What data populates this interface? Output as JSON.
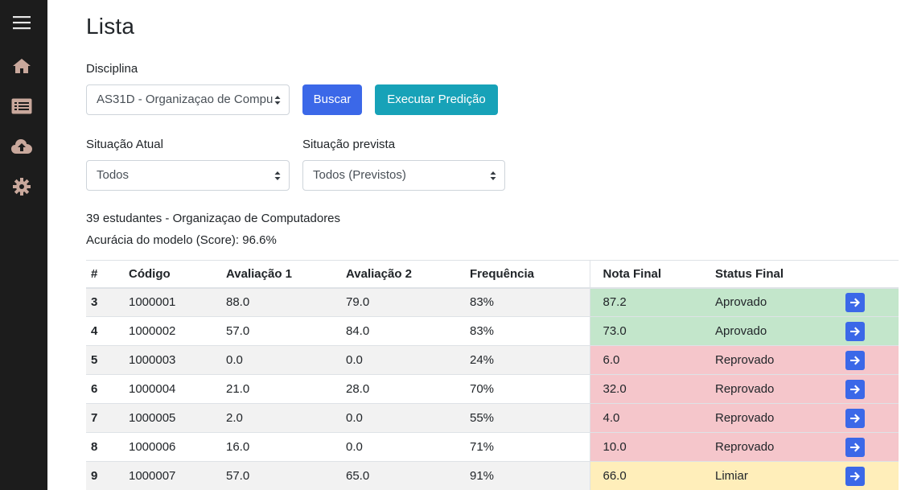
{
  "sidebar": {
    "items": [
      {
        "icon": "menu-icon"
      },
      {
        "icon": "home-icon"
      },
      {
        "icon": "list-icon"
      },
      {
        "icon": "cloud-upload-icon"
      },
      {
        "icon": "gear-icon"
      }
    ],
    "icon_color": "#c9a89c"
  },
  "page": {
    "title": "Lista"
  },
  "filters": {
    "disciplina_label": "Disciplina",
    "disciplina_value": "AS31D - Organizaçao de Compu",
    "buscar_label": "Buscar",
    "executar_label": "Executar Predição",
    "situacao_atual_label": "Situação Atual",
    "situacao_atual_value": "Todos",
    "situacao_prevista_label": "Situação prevista",
    "situacao_prevista_value": "Todos (Previstos)"
  },
  "summary": {
    "students": "39 estudantes - Organizaçao de Computadores",
    "accuracy": "Acurácia do modelo (Score): 96.6%"
  },
  "table": {
    "headers": [
      "#",
      "Código",
      "Avaliação 1",
      "Avaliação 2",
      "Frequência",
      "Nota Final",
      "Status Final"
    ],
    "rows": [
      {
        "num": "3",
        "codigo": "1000001",
        "av1": "88.0",
        "av2": "79.0",
        "freq": "83%",
        "nota": "87.2",
        "status": "Aprovado",
        "tone": "ok"
      },
      {
        "num": "4",
        "codigo": "1000002",
        "av1": "57.0",
        "av2": "84.0",
        "freq": "83%",
        "nota": "73.0",
        "status": "Aprovado",
        "tone": "ok"
      },
      {
        "num": "5",
        "codigo": "1000003",
        "av1": "0.0",
        "av2": "0.0",
        "freq": "24%",
        "nota": "6.0",
        "status": "Reprovado",
        "tone": "bad"
      },
      {
        "num": "6",
        "codigo": "1000004",
        "av1": "21.0",
        "av2": "28.0",
        "freq": "70%",
        "nota": "32.0",
        "status": "Reprovado",
        "tone": "bad"
      },
      {
        "num": "7",
        "codigo": "1000005",
        "av1": "2.0",
        "av2": "0.0",
        "freq": "55%",
        "nota": "4.0",
        "status": "Reprovado",
        "tone": "bad"
      },
      {
        "num": "8",
        "codigo": "1000006",
        "av1": "16.0",
        "av2": "0.0",
        "freq": "71%",
        "nota": "10.0",
        "status": "Reprovado",
        "tone": "bad"
      },
      {
        "num": "9",
        "codigo": "1000007",
        "av1": "57.0",
        "av2": "65.0",
        "freq": "91%",
        "nota": "66.0",
        "status": "Limiar",
        "tone": "warn"
      }
    ]
  },
  "colors": {
    "sidebar_bg": "#1c1c1c",
    "primary": "#3b68e8",
    "info": "#17a2b8",
    "success_bg": "#c3e6cb",
    "danger_bg": "#f5c6cb",
    "warning_bg": "#ffeeba"
  }
}
